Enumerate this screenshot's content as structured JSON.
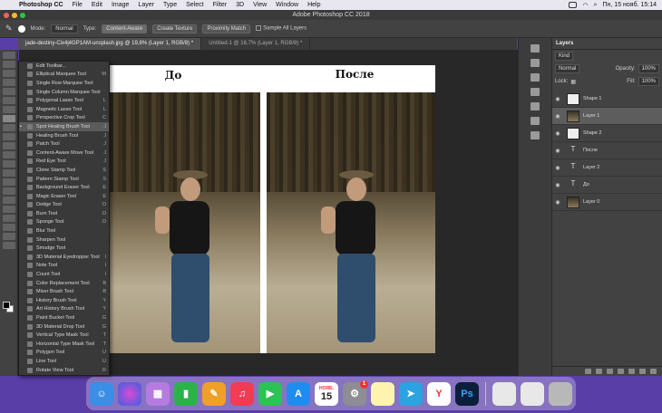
{
  "menubar": {
    "app_name": "Photoshop CC",
    "items": [
      "File",
      "Edit",
      "Image",
      "Layer",
      "Type",
      "Select",
      "Filter",
      "3D",
      "View",
      "Window",
      "Help"
    ],
    "clock": "Пн, 15 нояб.  15:14"
  },
  "window": {
    "title": "Adobe Photoshop CC 2018"
  },
  "options_bar": {
    "mode_label": "Mode:",
    "mode_value": "Normal",
    "type_label": "Type:",
    "type_buttons": [
      "Content-Aware",
      "Create Texture",
      "Proximity Match"
    ],
    "sample_all_layers": "Sample All Layers"
  },
  "tabs": [
    {
      "label": "jade-destiny-Cix4j4GP1AM-unsplash.jpg @ 19,8% (Layer 1, RGB/8) *",
      "active": true
    },
    {
      "label": "Untitled-1 @ 16,7% (Layer 1, RGB/8) *",
      "active": false
    }
  ],
  "canvas": {
    "label_before": "До",
    "label_after": "После"
  },
  "tool_menu": [
    {
      "label": "Edit Toolbar...",
      "key": ""
    },
    {
      "label": "Elliptical Marquee Tool",
      "key": "M"
    },
    {
      "label": "Single Row Marquee Tool",
      "key": ""
    },
    {
      "label": "Single Column Marquee Tool",
      "key": ""
    },
    {
      "label": "Polygonal Lasso Tool",
      "key": "L"
    },
    {
      "label": "Magnetic Lasso Tool",
      "key": "L"
    },
    {
      "label": "Perspective Crop Tool",
      "key": "C"
    },
    {
      "label": "Spot Healing Brush Tool",
      "key": "J",
      "selected": true
    },
    {
      "label": "Healing Brush Tool",
      "key": "J"
    },
    {
      "label": "Patch Tool",
      "key": "J"
    },
    {
      "label": "Content-Aware Move Tool",
      "key": "J"
    },
    {
      "label": "Red Eye Tool",
      "key": "J"
    },
    {
      "label": "Clone Stamp Tool",
      "key": "S"
    },
    {
      "label": "Pattern Stamp Tool",
      "key": "S"
    },
    {
      "label": "Background Eraser Tool",
      "key": "E"
    },
    {
      "label": "Magic Eraser Tool",
      "key": "E"
    },
    {
      "label": "Dodge Tool",
      "key": "O"
    },
    {
      "label": "Burn Tool",
      "key": "O"
    },
    {
      "label": "Sponge Tool",
      "key": "O"
    },
    {
      "label": "Blur Tool",
      "key": ""
    },
    {
      "label": "Sharpen Tool",
      "key": ""
    },
    {
      "label": "Smudge Tool",
      "key": ""
    },
    {
      "label": "3D Material Eyedropper Tool",
      "key": "I"
    },
    {
      "label": "Note Tool",
      "key": "I"
    },
    {
      "label": "Count Tool",
      "key": "I"
    },
    {
      "label": "Color Replacement Tool",
      "key": "B"
    },
    {
      "label": "Mixer Brush Tool",
      "key": "B"
    },
    {
      "label": "History Brush Tool",
      "key": "Y"
    },
    {
      "label": "Art History Brush Tool",
      "key": "Y"
    },
    {
      "label": "Paint Bucket Tool",
      "key": "G"
    },
    {
      "label": "3D Material Drop Tool",
      "key": "G"
    },
    {
      "label": "Vertical Type Mask Tool",
      "key": "T"
    },
    {
      "label": "Horizontal Type Mask Tool",
      "key": "T"
    },
    {
      "label": "Polygon Tool",
      "key": "U"
    },
    {
      "label": "Line Tool",
      "key": "U"
    },
    {
      "label": "Rotate View Tool",
      "key": "R"
    }
  ],
  "layers_panel": {
    "title": "Layers",
    "kind": "Kind",
    "blend_mode": "Normal",
    "opacity_label": "Opacity:",
    "opacity_value": "100%",
    "lock_label": "Lock:",
    "fill_label": "Fill:",
    "fill_value": "100%",
    "layers": [
      {
        "name": "Shape 1",
        "type": "shape",
        "selected": false
      },
      {
        "name": "Layer 1",
        "type": "photo",
        "selected": true
      },
      {
        "name": "Shape 2",
        "type": "shape",
        "selected": false
      },
      {
        "name": "После",
        "type": "text",
        "selected": false
      },
      {
        "name": "Layer 2",
        "type": "text",
        "selected": false
      },
      {
        "name": "До",
        "type": "text",
        "selected": false
      },
      {
        "name": "Layer 0",
        "type": "photo",
        "selected": false
      }
    ]
  },
  "dock": {
    "calendar_month": "НОЯБ.",
    "calendar_day": "15",
    "settings_badge": "1",
    "photoshop_label": "Ps"
  }
}
